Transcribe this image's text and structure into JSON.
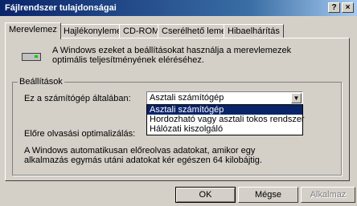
{
  "window": {
    "title": "Fájlrendszer tulajdonságai",
    "help_label": "?",
    "close_label": "×"
  },
  "tabs": [
    {
      "label": "Merevlemez"
    },
    {
      "label": "Hajlékonylemez"
    },
    {
      "label": "CD-ROM"
    },
    {
      "label": "Cserélhető lemez"
    },
    {
      "label": "Hibaelhárítás"
    }
  ],
  "panel": {
    "intro": "A Windows ezeket a beállításokat használja a merevlemezek optimális teljesítményének eléréséhez.",
    "group_label": "Beállítások",
    "machine_label": "Ez a számítógép általában:",
    "machine_value": "Asztali számítógép",
    "machine_options": [
      "Asztali számítógép",
      "Hordozható vagy asztali tokos rendszer",
      "Hálózati kiszolgáló"
    ],
    "readahead_label": "Előre olvasási optimalizálás:",
    "footer": "A Windows automatikusan előreolvas adatokat, amikor egy alkalmazás egymás utáni adatokat kér egészen 64 kilobájtig."
  },
  "buttons": {
    "ok": "OK",
    "cancel": "Mégse",
    "apply": "Alkalmaz"
  }
}
